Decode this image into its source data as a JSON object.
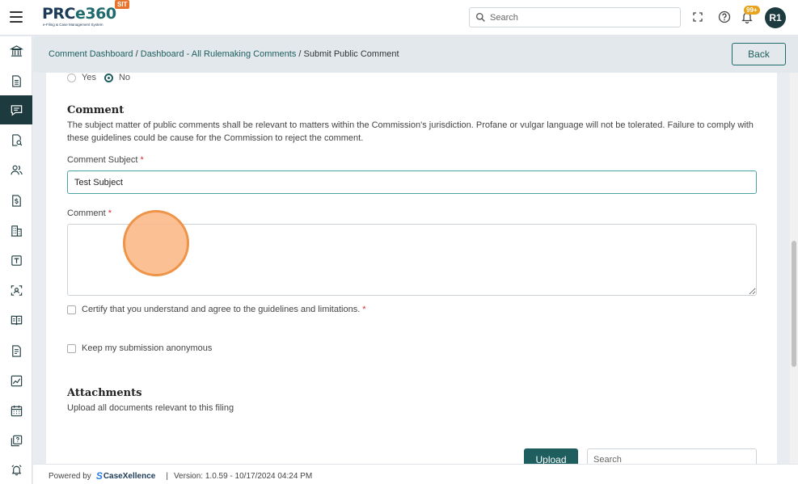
{
  "header": {
    "logo_text": "PRCe360",
    "logo_subtitle": "e-Filing & Case Management System",
    "env_badge": "SIT",
    "search_placeholder": "Search",
    "notification_count": "99+",
    "user_initials": "R1"
  },
  "sidebar": {
    "items": [
      {
        "icon": "bank-icon",
        "active": false
      },
      {
        "icon": "document-icon",
        "active": false
      },
      {
        "icon": "comment-icon",
        "active": true
      },
      {
        "icon": "document-search-icon",
        "active": false
      },
      {
        "icon": "users-icon",
        "active": false
      },
      {
        "icon": "dollar-document-icon",
        "active": false
      },
      {
        "icon": "building-icon",
        "active": false
      },
      {
        "icon": "text-box-icon",
        "active": false
      },
      {
        "icon": "scan-user-icon",
        "active": false
      },
      {
        "icon": "book-open-icon",
        "active": false
      },
      {
        "icon": "file-lines-icon",
        "active": false
      },
      {
        "icon": "chart-icon",
        "active": false
      },
      {
        "icon": "calendar-icon",
        "active": false
      },
      {
        "icon": "copy-help-icon",
        "active": false
      },
      {
        "icon": "alarm-icon",
        "active": false
      }
    ]
  },
  "breadcrumb": {
    "items": [
      "Comment Dashboard",
      "Dashboard - All Rulemaking Comments",
      "Submit Public Comment"
    ],
    "separator": "/",
    "back_label": "Back"
  },
  "form": {
    "radio_options": [
      {
        "label": "Yes",
        "selected": false
      },
      {
        "label": "No",
        "selected": true
      }
    ],
    "comment_section": {
      "title": "Comment",
      "description": "The subject matter of public comments shall be relevant to matters within the Commission's jurisdiction. Profane or vulgar language will not be tolerated. Failure to comply with these guidelines could be cause for the Commission to reject the comment."
    },
    "subject_label": "Comment Subject",
    "subject_value": "Test Subject",
    "comment_label": "Comment",
    "comment_value": "",
    "required_mark": "*",
    "certify_label": "Certify that you understand and agree to the guidelines and limitations.",
    "certify_checked": false,
    "anonymous_label": "Keep my submission anonymous",
    "anonymous_checked": false
  },
  "attachments": {
    "title": "Attachments",
    "description": "Upload all documents relevant to this filing",
    "upload_label": "Upload",
    "search_placeholder": "Search"
  },
  "footer": {
    "powered_by": "Powered by",
    "brand": "CaseXellence",
    "separator": "|",
    "version": "Version: 1.0.59 - 10/17/2024 04:24 PM"
  },
  "colors": {
    "primary": "#1e5e5f",
    "sidebar_active": "#1d3a3e",
    "badge": "#e8742b",
    "notification": "#e8a21b",
    "required": "#d32f2f"
  }
}
